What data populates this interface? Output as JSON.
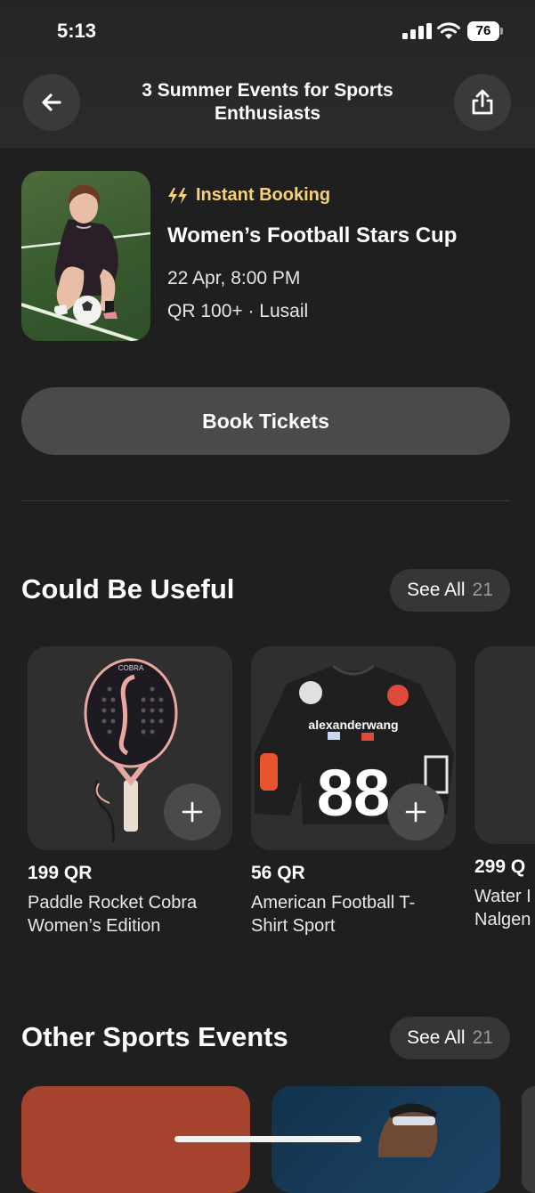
{
  "status_bar": {
    "time": "5:13",
    "battery": "76"
  },
  "header": {
    "title": "3 Summer Events for Sports Enthusiasts"
  },
  "event": {
    "badge": "Instant Booking",
    "title": "Women’s Football Stars Cup",
    "date": "22 Apr, 8:00 PM",
    "price_location": "QR 100+ · Lusail",
    "book_label": "Book Tickets"
  },
  "useful": {
    "title": "Could Be Useful",
    "see_all": "See All",
    "count": "21",
    "products": [
      {
        "price": "199 QR",
        "name_line1": "Paddle Rocket Cobra",
        "name_line2": "Women’s Edition"
      },
      {
        "price": "56 QR",
        "name_line1": "American Football T-",
        "name_line2": "Shirt Sport"
      },
      {
        "price": "299 Q",
        "name_line1": "Water I",
        "name_line2": "Nalgen"
      }
    ],
    "jersey_text": "alexanderwang",
    "jersey_number": "88",
    "racket_brand": "COBRA"
  },
  "other_events": {
    "title": "Other Sports Events",
    "see_all": "See All",
    "count": "21"
  },
  "colors": {
    "background": "#1f1f1f",
    "accent": "#f5d27a",
    "button": "#4a4a4a"
  }
}
